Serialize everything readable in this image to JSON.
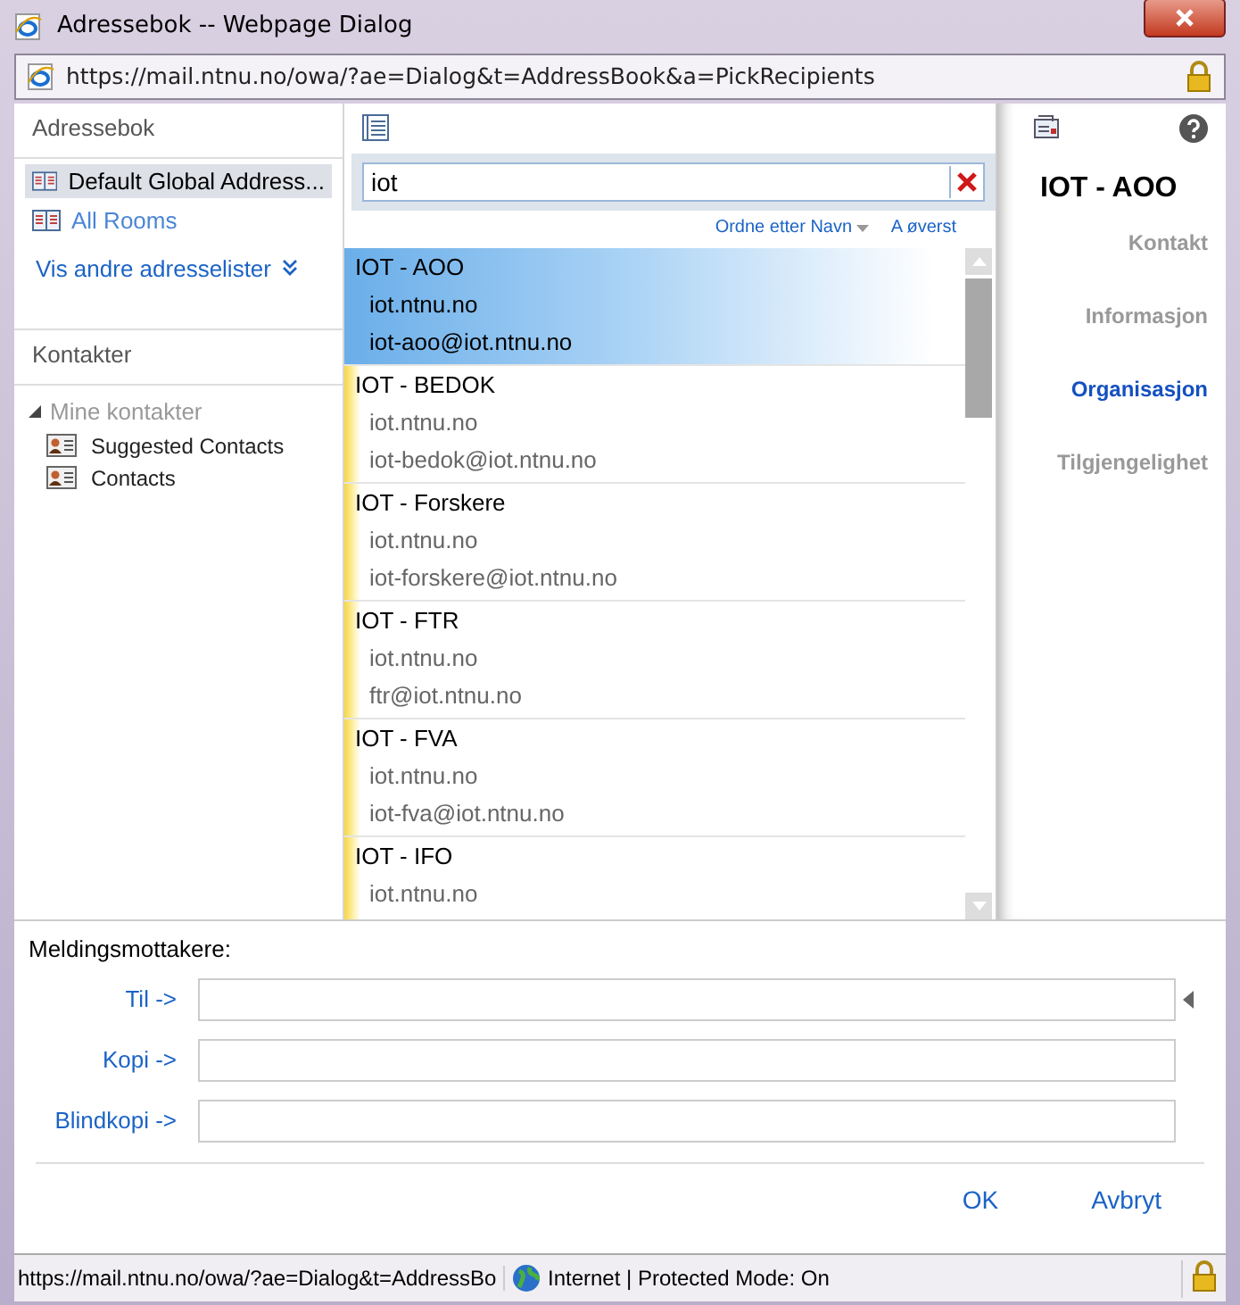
{
  "window": {
    "title": "Adressebok -- Webpage Dialog",
    "url": "https://mail.ntnu.no/owa/?ae=Dialog&t=AddressBook&a=PickRecipients"
  },
  "sidebar": {
    "heading": "Adressebok",
    "address_lists": [
      {
        "label": "Default Global Address...",
        "selected": true
      },
      {
        "label": "All Rooms",
        "selected": false
      }
    ],
    "more_link": "Vis andre adresselister",
    "contacts_heading": "Kontakter",
    "contacts_tree": [
      {
        "label": "Mine kontakter",
        "expanded": true,
        "children": [
          {
            "label": "Suggested Contacts"
          },
          {
            "label": "Contacts"
          }
        ]
      }
    ]
  },
  "search": {
    "value": "iot"
  },
  "sort": {
    "label": "Ordne etter Navn",
    "top_link": "A øverst"
  },
  "results": [
    {
      "name": "IOT - AOO",
      "domain": "iot.ntnu.no",
      "email": "iot-aoo@iot.ntnu.no",
      "selected": true
    },
    {
      "name": "IOT - BEDOK",
      "domain": "iot.ntnu.no",
      "email": "iot-bedok@iot.ntnu.no",
      "selected": false
    },
    {
      "name": "IOT - Forskere",
      "domain": "iot.ntnu.no",
      "email": "iot-forskere@iot.ntnu.no",
      "selected": false
    },
    {
      "name": "IOT - FTR",
      "domain": "iot.ntnu.no",
      "email": "ftr@iot.ntnu.no",
      "selected": false
    },
    {
      "name": "IOT - FVA",
      "domain": "iot.ntnu.no",
      "email": "iot-fva@iot.ntnu.no",
      "selected": false
    },
    {
      "name": "IOT - IFO",
      "domain": "iot.ntnu.no",
      "selected": false
    }
  ],
  "details": {
    "name": "IOT - AOO",
    "sections": [
      {
        "label": "Kontakt",
        "selected": false
      },
      {
        "label": "Informasjon",
        "selected": false
      },
      {
        "label": "Organisasjon",
        "selected": true
      },
      {
        "label": "Tilgjengelighet",
        "selected": false
      }
    ]
  },
  "recipients": {
    "heading": "Meldingsmottakere:",
    "fields": [
      {
        "label": "Til ->"
      },
      {
        "label": "Kopi ->"
      },
      {
        "label": "Blindkopi ->"
      }
    ]
  },
  "buttons": [
    "OK",
    "Avbryt"
  ],
  "status_bar": {
    "url": "https://mail.ntnu.no/owa/?ae=Dialog&t=AddressBo",
    "zone": "Internet | Protected Mode: On"
  }
}
